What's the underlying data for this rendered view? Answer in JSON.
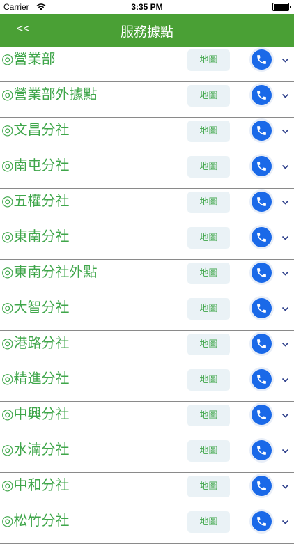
{
  "status_bar": {
    "carrier": "Carrier",
    "time": "3:35 PM"
  },
  "nav": {
    "back_label": "<<",
    "title": "服務據點"
  },
  "locations": [
    {
      "name": "◎營業部",
      "map_label": "地圖"
    },
    {
      "name": "◎營業部外據點",
      "map_label": "地圖"
    },
    {
      "name": "◎文昌分社",
      "map_label": "地圖"
    },
    {
      "name": "◎南屯分社",
      "map_label": "地圖"
    },
    {
      "name": "◎五權分社",
      "map_label": "地圖"
    },
    {
      "name": "◎東南分社",
      "map_label": "地圖"
    },
    {
      "name": "◎東南分社外點",
      "map_label": "地圖"
    },
    {
      "name": "◎大智分社",
      "map_label": "地圖"
    },
    {
      "name": "◎港路分社",
      "map_label": "地圖"
    },
    {
      "name": "◎精進分社",
      "map_label": "地圖"
    },
    {
      "name": "◎中興分社",
      "map_label": "地圖"
    },
    {
      "name": "◎水湳分社",
      "map_label": "地圖"
    },
    {
      "name": "◎中和分社",
      "map_label": "地圖"
    },
    {
      "name": "◎松竹分社",
      "map_label": "地圖"
    }
  ],
  "colors": {
    "nav_bg": "#4aa035",
    "accent_green": "#3fa64a",
    "phone_blue": "#1a69e8",
    "map_button_bg": "#eaf2f6"
  },
  "icons": {
    "phone": "phone-icon",
    "expand": "chevron-down-icon",
    "wifi": "wifi-icon",
    "battery": "battery-icon"
  }
}
